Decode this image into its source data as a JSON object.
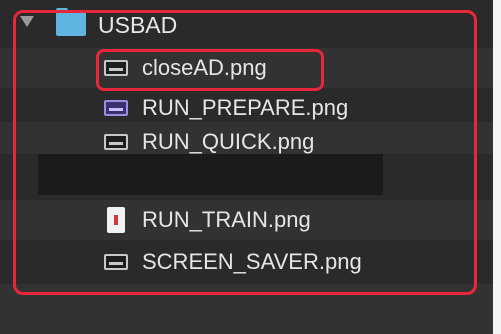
{
  "folder": {
    "name": "USBAD",
    "icon": "folder-icon",
    "expanded": true
  },
  "files": [
    {
      "name": "closeAD.png",
      "icon": "image-file-icon"
    },
    {
      "name": "RUN_PREPARE.png",
      "icon": "image-file-icon"
    },
    {
      "name": "RUN_QUICK.png",
      "icon": "image-file-icon"
    },
    {
      "name": "RUN_TRAIN.png",
      "icon": "image-file-icon"
    },
    {
      "name": "SCREEN_SAVER.png",
      "icon": "image-file-icon"
    }
  ],
  "colors": {
    "background": "#2a2a2a",
    "folder": "#5fb4e0",
    "highlight": "#e8283a",
    "text": "#e6e6e6"
  }
}
